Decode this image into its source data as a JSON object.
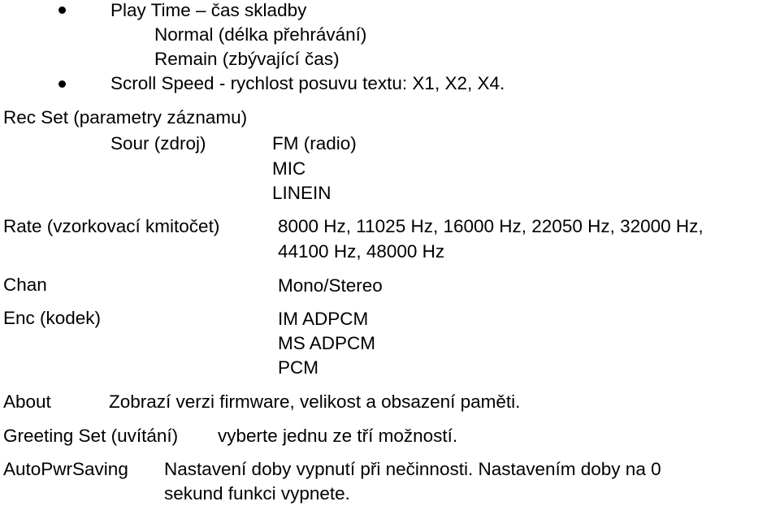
{
  "play_time": {
    "heading": "Play Time – čas skladby",
    "options": [
      "Normal (délka přehrávání)",
      "Remain (zbývající čas)"
    ]
  },
  "scroll_speed": {
    "text": "Scroll Speed - rychlost posuvu textu: X1, X2, X4."
  },
  "rec_set": {
    "heading": "Rec Set (parametry záznamu)",
    "source": {
      "label": "Sour (zdroj)",
      "options": [
        "FM (radio)",
        "MIC",
        "LINEIN"
      ]
    },
    "rate": {
      "label": "Rate (vzorkovací kmitočet)",
      "lines": [
        "8000 Hz, 11025 Hz, 16000 Hz, 22050 Hz, 32000 Hz,",
        "44100 Hz, 48000 Hz"
      ]
    },
    "chan": {
      "label": "Chan",
      "value": "Mono/Stereo"
    },
    "enc": {
      "label": "Enc (kodek)",
      "options": [
        "IM ADPCM",
        "MS ADPCM",
        "PCM"
      ]
    }
  },
  "about": {
    "label": "About",
    "text": "Zobrazí verzi firmware, velikost a obsazení paměti."
  },
  "greeting": {
    "label": "Greeting Set (uvítání)",
    "text": "vyberte jednu ze tří možností."
  },
  "auto_pwr": {
    "label": "AutoPwrSaving",
    "lines": [
      "Nastavení doby vypnutí při nečinnosti. Nastavením doby na 0",
      "sekund funkci vypnete."
    ]
  }
}
